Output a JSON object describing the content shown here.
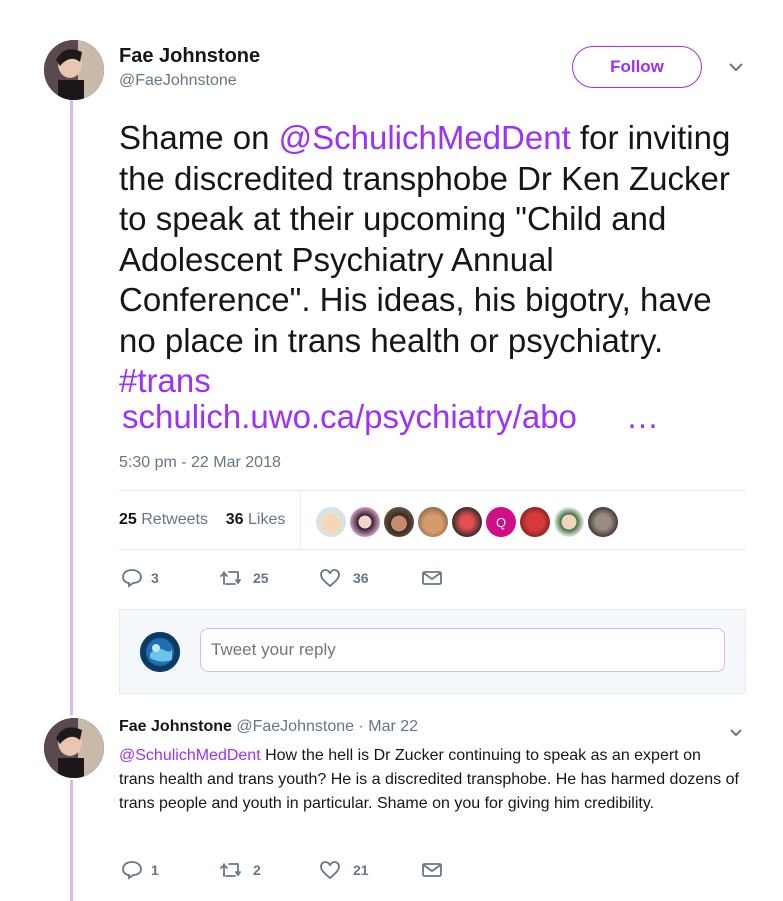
{
  "tweet": {
    "author_name": "Fae Johnstone",
    "author_handle": "@FaeJohnstone",
    "follow_label": "Follow",
    "text_part1": "Shame on ",
    "mention": "@SchulichMedDent",
    "text_part2": " for inviting the discredited transphobe Dr Ken Zucker to speak at their upcoming \"Child and Adolescent Psychiatry Annual Conference\". His ideas, his bigotry, have no place in trans health or psychiatry.",
    "hashtag": "#trans",
    "url": "schulich.uwo.ca/psychiatry/abo",
    "url_ellipsis": "…",
    "timestamp": "5:30 pm - 22 Mar 2018",
    "retweets_count": "25",
    "retweets_label": "Retweets",
    "likes_count": "36",
    "likes_label": "Likes",
    "actions": {
      "replies": "3",
      "retweets": "25",
      "likes": "36"
    }
  },
  "reply_box": {
    "placeholder": "Tweet your reply"
  },
  "reply": {
    "author_name": "Fae Johnstone",
    "author_handle": "@FaeJohnstone",
    "separator": " · ",
    "date": "Mar 22",
    "mention": "@SchulichMedDent",
    "text": " How the hell is Dr Zucker continuing to speak as an expert on trans health and trans youth? He is a discredited transphobe. He has harmed dozens of trans people and youth in particular. Shame on you for giving him credibility.",
    "actions": {
      "replies": "1",
      "retweets": "2",
      "likes": "21"
    }
  },
  "colors": {
    "accent": "#9b30ff",
    "thread_line": "#d8b8f7",
    "muted": "#657786"
  },
  "icons": [
    "chevron-down-icon",
    "reply-icon",
    "retweet-icon",
    "like-icon",
    "dm-icon"
  ]
}
